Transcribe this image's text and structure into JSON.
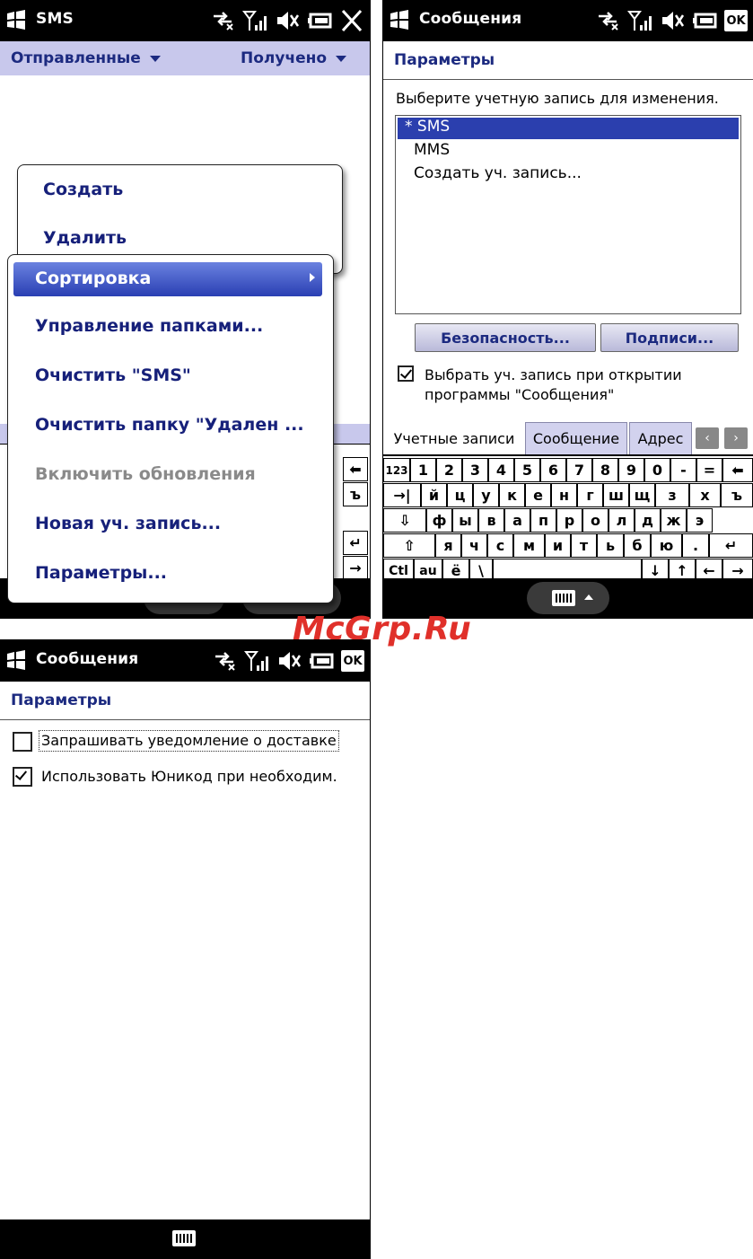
{
  "watermark": "McGrp.Ru",
  "screen1": {
    "title": "SMS",
    "folder_dropdown": "Отправленные",
    "sort_dropdown": "Получено",
    "menu_items": [
      {
        "label": "Создать"
      },
      {
        "label": "Удалить"
      },
      {
        "label": "Сортировка"
      },
      {
        "label": "Управление папками..."
      },
      {
        "label": "Очистить \"SMS\""
      },
      {
        "label": "Очистить папку \"Удален ..."
      },
      {
        "label": "Включить обновления"
      },
      {
        "label": "Новая уч. запись..."
      },
      {
        "label": "Параметры..."
      }
    ]
  },
  "screen2": {
    "title": "Сообщения",
    "ok_label": "OK",
    "page_title": "Параметры",
    "prompt": "Выберите учетную запись для изменения.",
    "accounts": [
      "* SMS",
      "MMS",
      "Создать уч. запись..."
    ],
    "security_button": "Безопасность...",
    "signatures_button": "Подписи...",
    "checkbox_line1": "Выбрать уч. запись при открытии",
    "checkbox_line2": "программы \"Сообщения\"",
    "tabs": [
      "Учетные записи",
      "Сообщение",
      "Адрес"
    ],
    "keyboard": {
      "row1": [
        "123",
        "1",
        "2",
        "3",
        "4",
        "5",
        "6",
        "7",
        "8",
        "9",
        "0",
        "-",
        "=",
        "⬅"
      ],
      "row2": [
        "→|",
        "й",
        "ц",
        "у",
        "к",
        "е",
        "н",
        "г",
        "ш",
        "щ",
        "з",
        "х",
        "ъ"
      ],
      "row3": [
        "⇩",
        "ф",
        "ы",
        "в",
        "а",
        "п",
        "р",
        "о",
        "л",
        "д",
        "ж",
        "э"
      ],
      "row4": [
        "⇧",
        "я",
        "ч",
        "с",
        "м",
        "и",
        "т",
        "ь",
        "б",
        "ю",
        ".",
        "↵"
      ],
      "row5": [
        "Ctl",
        "au",
        "ё",
        "\\",
        "↓",
        "↑",
        "←",
        "→"
      ]
    }
  },
  "screen3": {
    "title": "Сообщения",
    "ok_label": "OK",
    "page_title": "Параметры",
    "option1": "Запрашивать уведомление о доставке",
    "option2": "Использовать Юникод при необходим."
  }
}
